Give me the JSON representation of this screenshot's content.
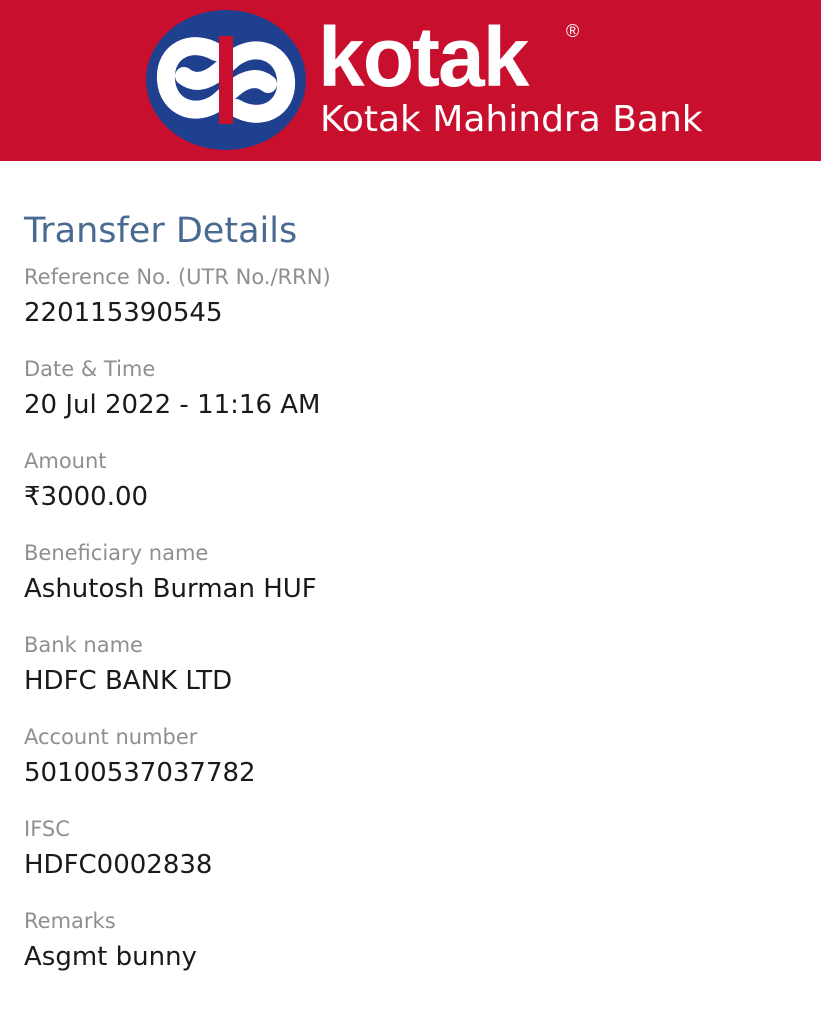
{
  "header": {
    "brand_name": "kotak",
    "registered_mark": "®",
    "bank_name": "Kotak Mahindra Bank",
    "logo_icon": "kotak-infinity-logo-icon",
    "colors": {
      "banner": "#c8102e",
      "logo_circle": "#1f3f8f",
      "text": "#ffffff"
    }
  },
  "transfer": {
    "title": "Transfer Details",
    "title_color": "#4a6a92",
    "fields": [
      {
        "label": "Reference No. (UTR No./RRN)",
        "value": "220115390545"
      },
      {
        "label": "Date & Time",
        "value": "20 Jul 2022 - 11:16 AM"
      },
      {
        "label": "Amount",
        "value": "₹3000.00"
      },
      {
        "label": "Beneficiary name",
        "value": "Ashutosh Burman HUF"
      },
      {
        "label": "Bank name",
        "value": "HDFC BANK LTD"
      },
      {
        "label": "Account number",
        "value": "50100537037782"
      },
      {
        "label": "IFSC",
        "value": "HDFC0002838"
      },
      {
        "label": "Remarks",
        "value": "Asgmt bunny"
      }
    ]
  }
}
